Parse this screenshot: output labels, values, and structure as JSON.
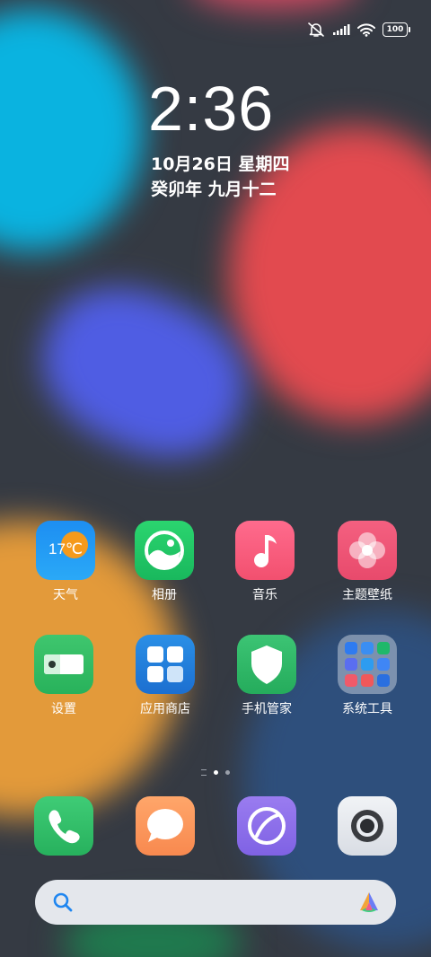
{
  "status_bar": {
    "icons": [
      "mute-icon",
      "signal-icon",
      "wifi-icon"
    ],
    "battery": "100"
  },
  "lock": {
    "time": "2:36",
    "date": "10月26日 星期四",
    "lunar": "癸卯年 九月十二"
  },
  "apps": [
    {
      "label": "天气",
      "badge": "17℃"
    },
    {
      "label": "相册"
    },
    {
      "label": "音乐"
    },
    {
      "label": "主题壁纸"
    },
    {
      "label": "设置"
    },
    {
      "label": "应用商店"
    },
    {
      "label": "手机管家"
    },
    {
      "label": "系统工具"
    }
  ],
  "dock": [
    "phone-icon",
    "messages-icon",
    "browser-icon",
    "camera-icon"
  ],
  "page_indicator": {
    "pages": 2,
    "current": 1
  },
  "search_bar": {
    "icon": "search-icon",
    "assistant": "ai-assistant-icon"
  },
  "colors": {
    "background": "#353a43",
    "accent_cyan": "#0ab3e0",
    "accent_red": "#e24a4f"
  }
}
